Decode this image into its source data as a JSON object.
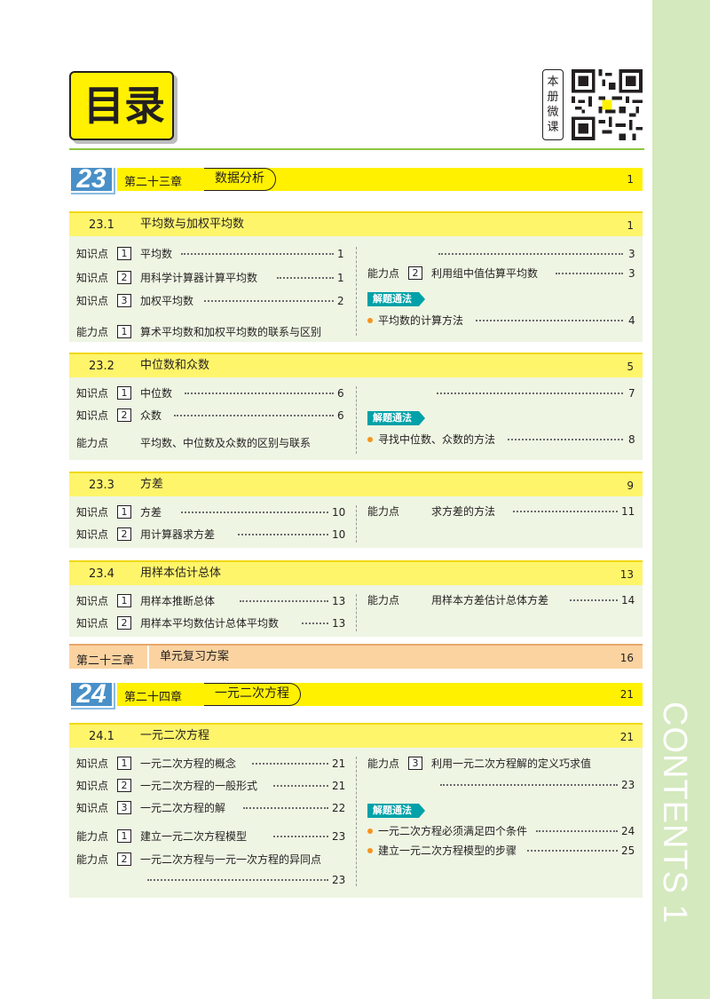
{
  "header": {
    "title": "目录",
    "qr_label": [
      "本",
      "册",
      "微",
      "课"
    ]
  },
  "side": {
    "text": "CONTENTS 1"
  },
  "chapter23": {
    "num": "23",
    "label": "第二十三章",
    "title": "数据分析",
    "page": "1"
  },
  "s231": {
    "num": "23.1",
    "title": "平均数与加权平均数",
    "page": "1",
    "left": [
      {
        "kind": "知识点",
        "box": "1",
        "text": "平均数",
        "page": "1"
      },
      {
        "kind": "知识点",
        "box": "2",
        "text": "用科学计算器计算平均数",
        "page": "1"
      },
      {
        "kind": "知识点",
        "box": "3",
        "text": "加权平均数",
        "page": "2"
      },
      {
        "kind": "能力点",
        "box": "1",
        "text": "算术平均数和加权平均数的联系与区别",
        "page": ""
      }
    ],
    "right_cont_page": "3",
    "right_item": {
      "kind": "能力点",
      "box": "2",
      "text": "利用组中值估算平均数",
      "page": "3"
    },
    "method_tag": "解题通法",
    "methods": [
      {
        "text": "平均数的计算方法",
        "page": "4"
      }
    ]
  },
  "s232": {
    "num": "23.2",
    "title": "中位数和众数",
    "page": "5",
    "left": [
      {
        "kind": "知识点",
        "box": "1",
        "text": "中位数",
        "page": "6"
      },
      {
        "kind": "知识点",
        "box": "2",
        "text": "众数",
        "page": "6"
      },
      {
        "kind": "能力点",
        "box": "",
        "text": "平均数、中位数及众数的区别与联系",
        "page": ""
      }
    ],
    "right_cont_page": "7",
    "method_tag": "解题通法",
    "methods": [
      {
        "text": "寻找中位数、众数的方法",
        "page": "8"
      }
    ]
  },
  "s233": {
    "num": "23.3",
    "title": "方差",
    "page": "9",
    "left": [
      {
        "kind": "知识点",
        "box": "1",
        "text": "方差",
        "page": "10"
      },
      {
        "kind": "知识点",
        "box": "2",
        "text": "用计算器求方差",
        "page": "10"
      }
    ],
    "right_item": {
      "kind": "能力点",
      "text": "求方差的方法",
      "page": "11"
    }
  },
  "s234": {
    "num": "23.4",
    "title": "用样本估计总体",
    "page": "13",
    "left": [
      {
        "kind": "知识点",
        "box": "1",
        "text": "用样本推断总体",
        "page": "13"
      },
      {
        "kind": "知识点",
        "box": "2",
        "text": "用样本平均数估计总体平均数",
        "page": "13"
      }
    ],
    "right_item": {
      "kind": "能力点",
      "text": "用样本方差估计总体方差",
      "page": "14"
    }
  },
  "review": {
    "label": "第二十三章",
    "title": "单元复习方案",
    "page": "16"
  },
  "chapter24": {
    "num": "24",
    "label": "第二十四章",
    "title": "一元二次方程",
    "page": "21"
  },
  "s241": {
    "num": "24.1",
    "title": "一元二次方程",
    "page": "21",
    "left": [
      {
        "kind": "知识点",
        "box": "1",
        "text": "一元二次方程的概念",
        "page": "21"
      },
      {
        "kind": "知识点",
        "box": "2",
        "text": "一元二次方程的一般形式",
        "page": "21"
      },
      {
        "kind": "知识点",
        "box": "3",
        "text": "一元二次方程的解",
        "page": "22"
      },
      {
        "kind": "能力点",
        "box": "1",
        "text": "建立一元二次方程模型",
        "page": "23"
      },
      {
        "kind": "能力点",
        "box": "2",
        "text": "一元二次方程与一元一次方程的异同点",
        "page": ""
      }
    ],
    "left_cont_page": "23",
    "right_item": {
      "kind": "能力点",
      "box": "3",
      "text": "利用一元二次方程解的定义巧求值",
      "page": ""
    },
    "right_cont_page": "23",
    "method_tag": "解题通法",
    "methods": [
      {
        "text": "一元二次方程必须满足四个条件",
        "page": "24"
      },
      {
        "text": "建立一元二次方程模型的步骤",
        "page": "25"
      }
    ]
  }
}
